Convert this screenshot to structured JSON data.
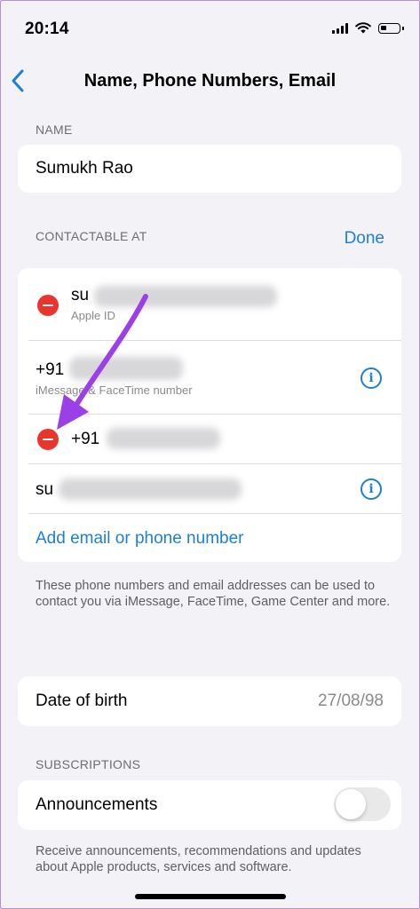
{
  "status_bar": {
    "time": "20:14"
  },
  "nav": {
    "title": "Name, Phone Numbers, Email"
  },
  "name_section": {
    "label": "NAME",
    "value": "Sumukh Rao"
  },
  "contactable": {
    "label": "CONTACTABLE AT",
    "done_label": "Done",
    "rows": [
      {
        "title": "su",
        "subtitle": "Apple ID",
        "has_delete": true,
        "has_info": false
      },
      {
        "title": "+91",
        "subtitle": "iMessage & FaceTime number",
        "has_delete": false,
        "has_info": true
      },
      {
        "title": "+91",
        "subtitle": "",
        "has_delete": true,
        "has_info": false
      },
      {
        "title": "su",
        "subtitle": "",
        "has_delete": false,
        "has_info": true
      }
    ],
    "add_label": "Add email or phone number",
    "footer": "These phone numbers and email addresses can be used to contact you via iMessage, FaceTime, Game Center and more."
  },
  "dob": {
    "label": "Date of birth",
    "value": "27/08/98"
  },
  "subscriptions": {
    "label": "SUBSCRIPTIONS",
    "item_label": "Announcements",
    "toggle_on": false,
    "footer": "Receive announcements, recommendations and updates about Apple products, services and software."
  },
  "colors": {
    "accent": "#1e7fd0",
    "delete": "#e8362f",
    "annotation_arrow": "#9b3fe6"
  }
}
